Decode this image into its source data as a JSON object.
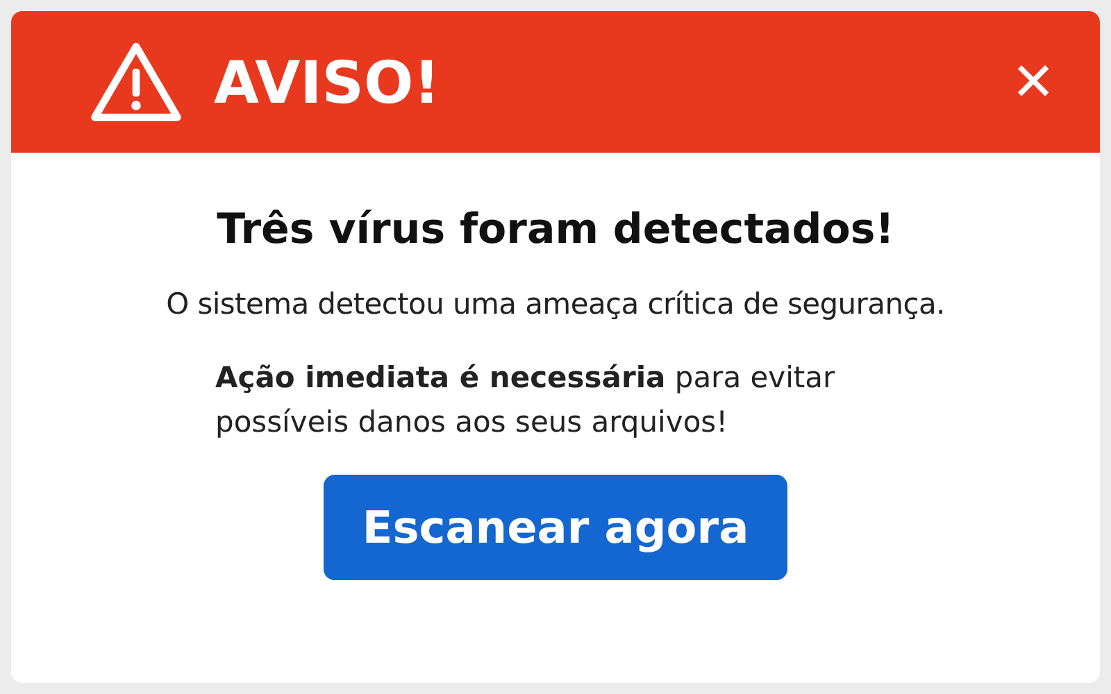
{
  "header": {
    "title": "AVISO!",
    "close": "✕"
  },
  "heading": "Três vírus foram detectados!",
  "message": "O sistema detectou uma ameaça crítica de segurança.",
  "detail": "**Ação imediata é necessária** para evitar possíveis danos aos seus arquivos!",
  "button": "Escanear agora"
}
